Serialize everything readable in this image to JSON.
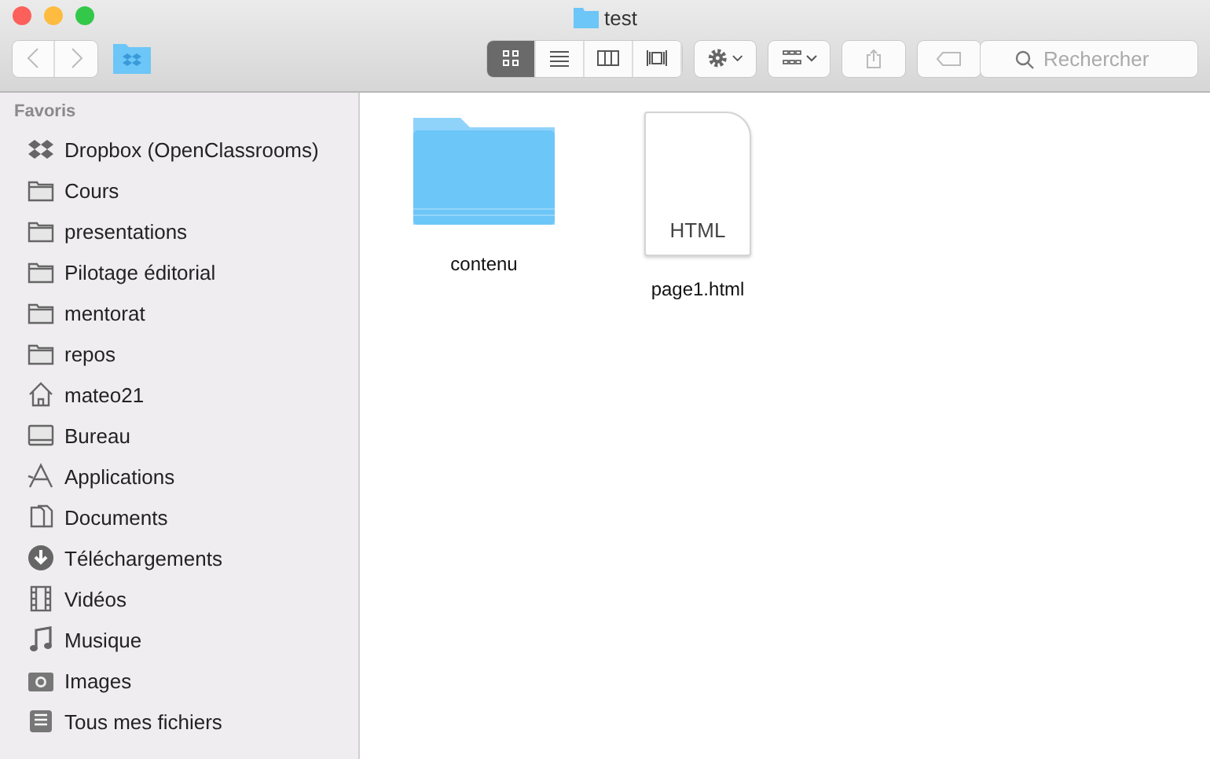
{
  "window": {
    "title": "test"
  },
  "toolbar": {
    "view_modes": [
      {
        "kind": "icons",
        "selected": true
      },
      {
        "kind": "list",
        "selected": false
      },
      {
        "kind": "columns",
        "selected": false
      },
      {
        "kind": "coverflow",
        "selected": false
      }
    ],
    "search": {
      "placeholder": "Rechercher"
    }
  },
  "sidebar": {
    "heading": "Favoris",
    "items": [
      {
        "kind": "dropbox",
        "label": "Dropbox (OpenClassrooms)"
      },
      {
        "kind": "folder",
        "label": "Cours"
      },
      {
        "kind": "folder",
        "label": "presentations"
      },
      {
        "kind": "folder",
        "label": "Pilotage éditorial"
      },
      {
        "kind": "folder",
        "label": "mentorat"
      },
      {
        "kind": "folder",
        "label": "repos"
      },
      {
        "kind": "home",
        "label": "mateo21"
      },
      {
        "kind": "desktop",
        "label": "Bureau"
      },
      {
        "kind": "apps",
        "label": "Applications"
      },
      {
        "kind": "documents",
        "label": "Documents"
      },
      {
        "kind": "download",
        "label": "Téléchargements"
      },
      {
        "kind": "movie",
        "label": "Vidéos"
      },
      {
        "kind": "music",
        "label": "Musique"
      },
      {
        "kind": "camera",
        "label": "Images"
      },
      {
        "kind": "allfiles",
        "label": "Tous mes fichiers"
      }
    ]
  },
  "files": [
    {
      "kind": "folder",
      "name": "contenu"
    },
    {
      "kind": "document",
      "name": "page1.html",
      "badge": "HTML"
    }
  ]
}
